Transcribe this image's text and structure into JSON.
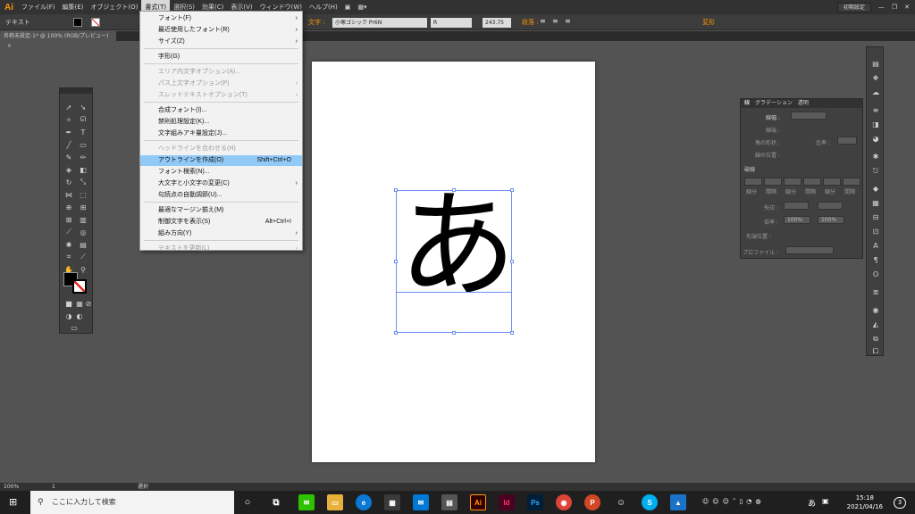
{
  "app": {
    "logo": "Ai"
  },
  "menubar": {
    "items": [
      "ファイル(F)",
      "編集(E)",
      "オブジェクト(O)",
      "書式(T)",
      "選択(S)",
      "効果(C)",
      "表示(V)",
      "ウィンドウ(W)",
      "ヘルプ(H)"
    ],
    "workspace": "初期設定"
  },
  "controlbar": {
    "mode_label": "テキスト",
    "char_label": "文字 :",
    "font_name": "小塚ゴシック Pr6N",
    "font_style": "R",
    "font_size": "243.75",
    "para_label": "段落 :",
    "transform_label": "変形"
  },
  "doc_tab": {
    "title": "名称未設定-1* @ 100% (RGB/プレビュー)"
  },
  "canvas": {
    "glyph": "あ"
  },
  "menu": {
    "items": [
      {
        "label": "フォント(F)",
        "submenu": true
      },
      {
        "label": "最近使用したフォント(R)",
        "submenu": true
      },
      {
        "label": "サイズ(Z)",
        "submenu": true
      },
      {
        "label": "字形(G)"
      },
      {
        "label": "エリア内文字オプション(A)...",
        "disabled": true
      },
      {
        "label": "パス上文字オプション(P)",
        "disabled": true,
        "submenu": true
      },
      {
        "label": "スレッドテキストオプション(T)",
        "disabled": true,
        "submenu": true
      },
      {
        "label": "合成フォント(I)..."
      },
      {
        "label": "禁則処理設定(K)..."
      },
      {
        "label": "文字組みアキ量設定(J)..."
      },
      {
        "label": "ヘッドラインを合わせる(H)",
        "disabled": true
      },
      {
        "label": "アウトラインを作成(O)",
        "shortcut": "Shift+Ctrl+O",
        "highlighted": true
      },
      {
        "label": "フォント検索(N)..."
      },
      {
        "label": "大文字と小文字の変更(C)",
        "submenu": true
      },
      {
        "label": "句読点の自動調節(U)..."
      },
      {
        "label": "最適なマージン揃え(M)"
      },
      {
        "label": "制御文字を表示(S)",
        "shortcut": "Alt+Ctrl+I"
      },
      {
        "label": "組み方向(Y)",
        "submenu": true
      },
      {
        "label": "テキストを更新(L)",
        "disabled": true,
        "submenu": true
      }
    ]
  },
  "char_panel": {
    "tabs": [
      "線",
      "グラデーション",
      "透明"
    ],
    "weight_label": "線幅 :",
    "line_label": "線端 :",
    "corner_label": "角の形状 :",
    "limit_label": "比率 :",
    "align_label": "線の位置 :",
    "dash_label": "破線",
    "dash_fields": [
      "線分",
      "間隔",
      "線分",
      "間隔",
      "線分",
      "間隔"
    ],
    "arrow_label": "矢印 :",
    "scale_label": "倍率 :",
    "scale_value_1": "100%",
    "scale_value_2": "100%",
    "arrow_pos_label": "先端位置 :",
    "profile_label": "プロファイル :"
  },
  "status": {
    "zoom": "100%",
    "page": "1",
    "selection": "選択"
  },
  "taskbar": {
    "search_placeholder": "ここに入力して検索",
    "time": "15:18",
    "date": "2021/04/16",
    "ime": "あ",
    "notification_count": "3"
  }
}
